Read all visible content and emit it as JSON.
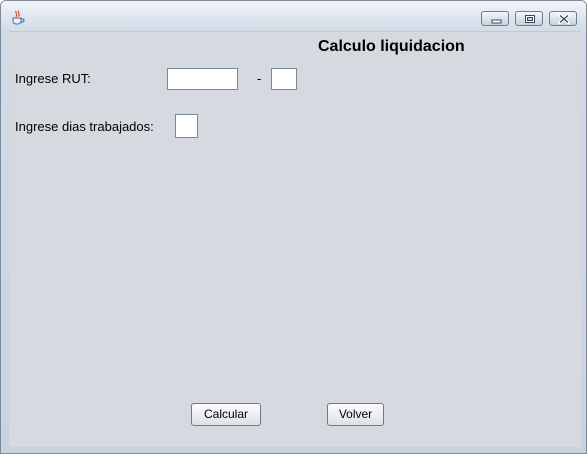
{
  "window": {
    "icon": "java-cup-icon",
    "controls": [
      "minimize-icon",
      "maximize-icon",
      "close-icon"
    ]
  },
  "form": {
    "title": "Calculo liquidacion",
    "rut_label": "Ingrese RUT:",
    "rut_value": "",
    "rut_separator": "-",
    "dv_value": "",
    "dias_label": "Ingrese dias trabajados:",
    "dias_value": ""
  },
  "buttons": {
    "calcular": "Calcular",
    "volver": "Volver"
  }
}
